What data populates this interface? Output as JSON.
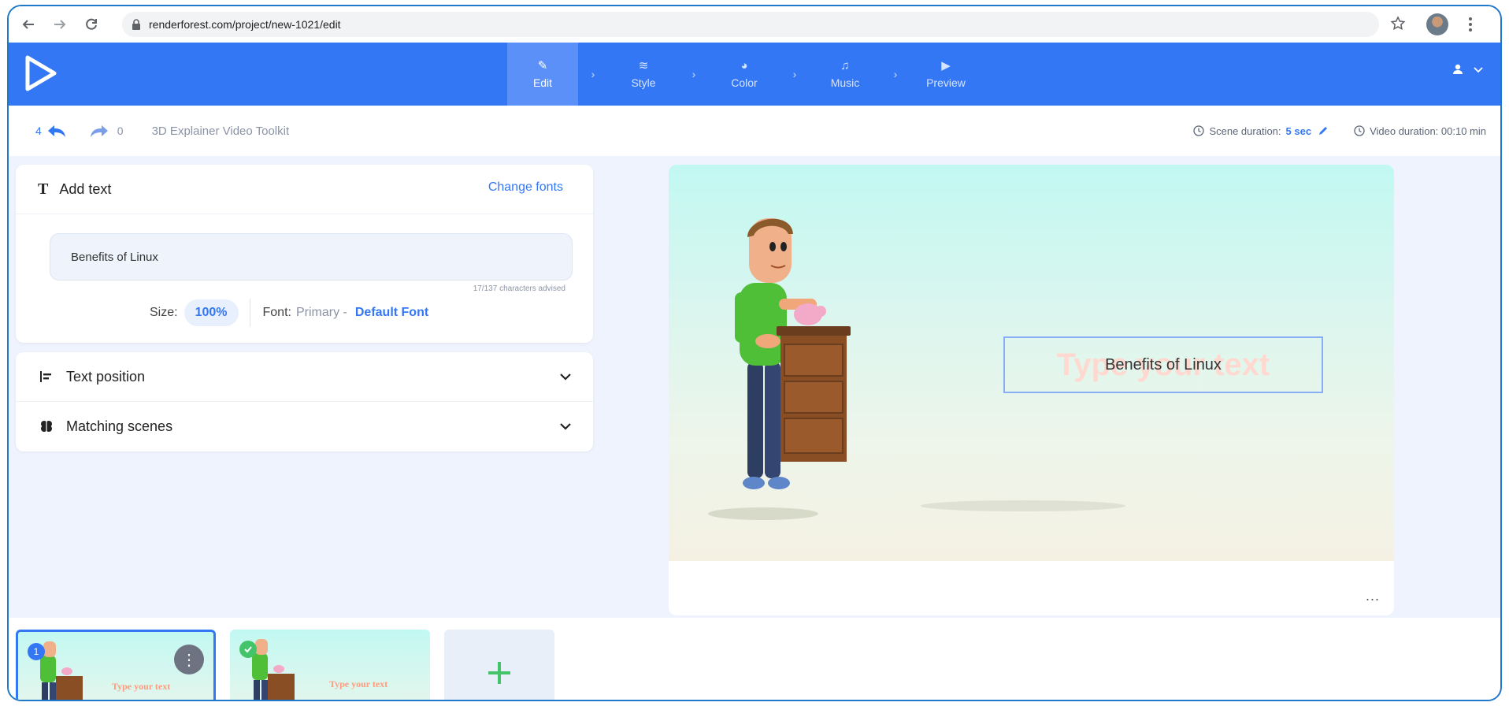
{
  "browser": {
    "url": "renderforest.com/project/new-1021/edit"
  },
  "header": {
    "steps": [
      {
        "label": "Edit",
        "icon": "pencil-icon"
      },
      {
        "label": "Style",
        "icon": "layers-icon"
      },
      {
        "label": "Color",
        "icon": "palette-icon"
      },
      {
        "label": "Music",
        "icon": "music-icon"
      },
      {
        "label": "Preview",
        "icon": "play-icon"
      }
    ],
    "active_step": "Edit",
    "accent": "#3477f5"
  },
  "toolbar": {
    "undo_count": "4",
    "redo_count": "0",
    "project_title": "3D Explainer Video Toolkit",
    "scene_duration_label": "Scene duration:",
    "scene_duration_value": "5 sec",
    "video_duration": "Video duration: 00:10 min"
  },
  "text_panel": {
    "title": "Add text",
    "change_fonts": "Change fonts",
    "input_value": "Benefits of Linux",
    "char_hint": "17/137 characters advised",
    "size_label": "Size:",
    "size_value": "100%",
    "font_label": "Font:",
    "font_value": "Primary -",
    "font_name": "Default Font"
  },
  "accordions": [
    {
      "label": "Text position",
      "icon": "align-left-icon"
    },
    {
      "label": "Matching scenes",
      "icon": "brain-icon"
    }
  ],
  "preview": {
    "ghost_text": "Type your text",
    "text": "Benefits of Linux",
    "more": "..."
  },
  "scenes": [
    {
      "number": "1",
      "text": "Type your text",
      "selected": true
    },
    {
      "number": "",
      "text": "Type your text",
      "completed": true
    }
  ]
}
